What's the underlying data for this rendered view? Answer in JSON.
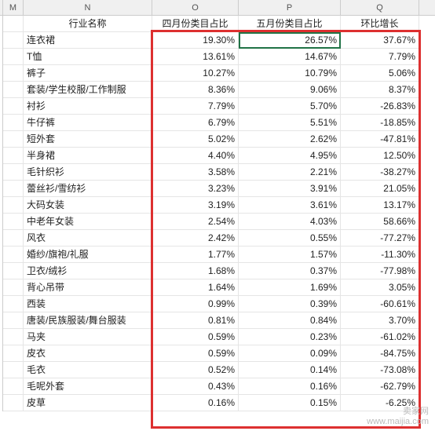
{
  "columns": {
    "M": "M",
    "N": "N",
    "O": "O",
    "P": "P",
    "Q": "Q"
  },
  "headers": {
    "name": "行业名称",
    "april": "四月份类目占比",
    "may": "五月份类目占比",
    "growth": "环比增长"
  },
  "rows": [
    {
      "name": "连衣裙",
      "april": "19.30%",
      "may": "26.57%",
      "growth": "37.67%"
    },
    {
      "name": "T恤",
      "april": "13.61%",
      "may": "14.67%",
      "growth": "7.79%"
    },
    {
      "name": "裤子",
      "april": "10.27%",
      "may": "10.79%",
      "growth": "5.06%"
    },
    {
      "name": "套装/学生校服/工作制服",
      "april": "8.36%",
      "may": "9.06%",
      "growth": "8.37%"
    },
    {
      "name": "衬衫",
      "april": "7.79%",
      "may": "5.70%",
      "growth": "-26.83%"
    },
    {
      "name": "牛仔裤",
      "april": "6.79%",
      "may": "5.51%",
      "growth": "-18.85%"
    },
    {
      "name": "短外套",
      "april": "5.02%",
      "may": "2.62%",
      "growth": "-47.81%"
    },
    {
      "name": "半身裙",
      "april": "4.40%",
      "may": "4.95%",
      "growth": "12.50%"
    },
    {
      "name": "毛针织衫",
      "april": "3.58%",
      "may": "2.21%",
      "growth": "-38.27%"
    },
    {
      "name": "蕾丝衫/雪纺衫",
      "april": "3.23%",
      "may": "3.91%",
      "growth": "21.05%"
    },
    {
      "name": "大码女装",
      "april": "3.19%",
      "may": "3.61%",
      "growth": "13.17%"
    },
    {
      "name": "中老年女装",
      "april": "2.54%",
      "may": "4.03%",
      "growth": "58.66%"
    },
    {
      "name": "风衣",
      "april": "2.42%",
      "may": "0.55%",
      "growth": "-77.27%"
    },
    {
      "name": "婚纱/旗袍/礼服",
      "april": "1.77%",
      "may": "1.57%",
      "growth": "-11.30%"
    },
    {
      "name": "卫衣/绒衫",
      "april": "1.68%",
      "may": "0.37%",
      "growth": "-77.98%"
    },
    {
      "name": "背心吊带",
      "april": "1.64%",
      "may": "1.69%",
      "growth": "3.05%"
    },
    {
      "name": "西装",
      "april": "0.99%",
      "may": "0.39%",
      "growth": "-60.61%"
    },
    {
      "name": "唐装/民族服装/舞台服装",
      "april": "0.81%",
      "may": "0.84%",
      "growth": "3.70%"
    },
    {
      "name": "马夹",
      "april": "0.59%",
      "may": "0.23%",
      "growth": "-61.02%"
    },
    {
      "name": "皮衣",
      "april": "0.59%",
      "may": "0.09%",
      "growth": "-84.75%"
    },
    {
      "name": "毛衣",
      "april": "0.52%",
      "may": "0.14%",
      "growth": "-73.08%"
    },
    {
      "name": "毛呢外套",
      "april": "0.43%",
      "may": "0.16%",
      "growth": "-62.79%"
    },
    {
      "name": "皮草",
      "april": "0.16%",
      "may": "0.15%",
      "growth": "-6.25%"
    }
  ],
  "watermark": {
    "line1": "卖家网",
    "line2": "www.maijia.com"
  },
  "chart_data": {
    "type": "table",
    "title": "行业名称",
    "columns": [
      "行业名称",
      "四月份类目占比",
      "五月份类目占比",
      "环比增长"
    ],
    "data": [
      [
        "连衣裙",
        19.3,
        26.57,
        37.67
      ],
      [
        "T恤",
        13.61,
        14.67,
        7.79
      ],
      [
        "裤子",
        10.27,
        10.79,
        5.06
      ],
      [
        "套装/学生校服/工作制服",
        8.36,
        9.06,
        8.37
      ],
      [
        "衬衫",
        7.79,
        5.7,
        -26.83
      ],
      [
        "牛仔裤",
        6.79,
        5.51,
        -18.85
      ],
      [
        "短外套",
        5.02,
        2.62,
        -47.81
      ],
      [
        "半身裙",
        4.4,
        4.95,
        12.5
      ],
      [
        "毛针织衫",
        3.58,
        2.21,
        -38.27
      ],
      [
        "蕾丝衫/雪纺衫",
        3.23,
        3.91,
        21.05
      ],
      [
        "大码女装",
        3.19,
        3.61,
        13.17
      ],
      [
        "中老年女装",
        2.54,
        4.03,
        58.66
      ],
      [
        "风衣",
        2.42,
        0.55,
        -77.27
      ],
      [
        "婚纱/旗袍/礼服",
        1.77,
        1.57,
        -11.3
      ],
      [
        "卫衣/绒衫",
        1.68,
        0.37,
        -77.98
      ],
      [
        "背心吊带",
        1.64,
        1.69,
        3.05
      ],
      [
        "西装",
        0.99,
        0.39,
        -60.61
      ],
      [
        "唐装/民族服装/舞台服装",
        0.81,
        0.84,
        3.7
      ],
      [
        "马夹",
        0.59,
        0.23,
        -61.02
      ],
      [
        "皮衣",
        0.59,
        0.09,
        -84.75
      ],
      [
        "毛衣",
        0.52,
        0.14,
        -73.08
      ],
      [
        "毛呢外套",
        0.43,
        0.16,
        -62.79
      ],
      [
        "皮草",
        0.16,
        0.15,
        -6.25
      ]
    ]
  }
}
